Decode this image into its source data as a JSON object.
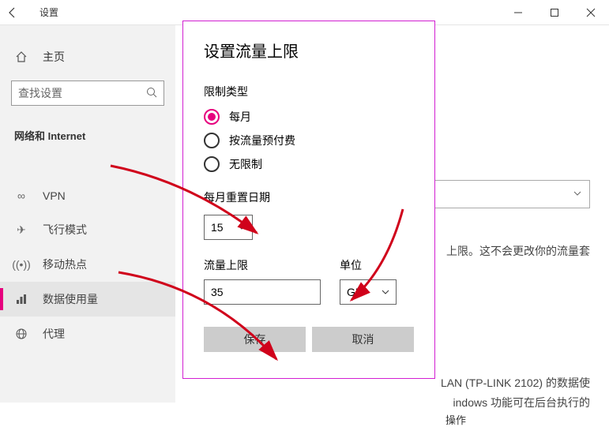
{
  "titlebar": {
    "title": "设置"
  },
  "sidebar": {
    "home": "主页",
    "search_placeholder": "查找设置",
    "section": "网络和 Internet",
    "items": [
      {
        "label": "VPN"
      },
      {
        "label": "飞行模式"
      },
      {
        "label": "移动热点"
      },
      {
        "label": "数据使用量"
      },
      {
        "label": "代理"
      }
    ]
  },
  "content": {
    "bg_text1": "上限。这不会更改你的流量套",
    "bg_text2": "LAN (TP-LINK 2102) 的数据使",
    "bg_text3": "indows 功能可在后台执行的",
    "operation": "操作"
  },
  "dialog": {
    "title": "设置流量上限",
    "limit_type_label": "限制类型",
    "radios": {
      "monthly": "每月",
      "prepaid": "按流量预付费",
      "unlimited": "无限制"
    },
    "reset_label": "每月重置日期",
    "reset_value": "15",
    "limit_label": "流量上限",
    "limit_value": "35",
    "unit_label": "单位",
    "unit_value": "GB",
    "save": "保存",
    "cancel": "取消"
  }
}
